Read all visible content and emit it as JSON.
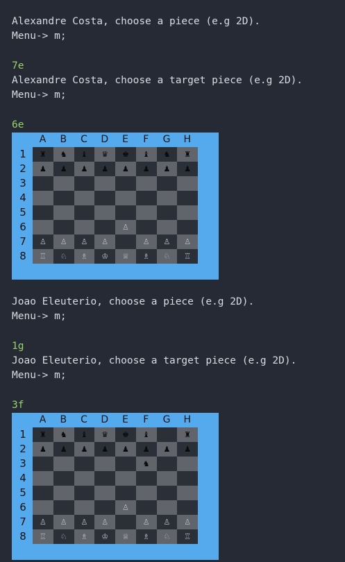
{
  "terminal": {
    "lines": [
      {
        "text": "Alexandre Costa, choose a piece (e.g 2D).",
        "type": "text"
      },
      {
        "text": "Menu-> m;",
        "type": "text"
      },
      {
        "text": "7e",
        "type": "input"
      },
      {
        "text": "Alexandre Costa, choose a target piece (e.g 2D).",
        "type": "text"
      },
      {
        "text": "Menu-> m;",
        "type": "text"
      },
      {
        "text": "6e",
        "type": "input"
      },
      {
        "text": "Joao Eleuterio, choose a piece (e.g 2D).",
        "type": "text"
      },
      {
        "text": "Menu-> m;",
        "type": "text"
      },
      {
        "text": "1g",
        "type": "input"
      },
      {
        "text": "Joao Eleuterio, choose a target piece (e.g 2D).",
        "type": "text"
      },
      {
        "text": "Menu-> m;",
        "type": "text"
      },
      {
        "text": "3f",
        "type": "input"
      }
    ]
  },
  "boards": [
    {
      "columns": [
        "A",
        "B",
        "C",
        "D",
        "E",
        "F",
        "G",
        "H"
      ],
      "rows": [
        "1",
        "2",
        "3",
        "4",
        "5",
        "6",
        "7",
        "8"
      ],
      "squares": [
        [
          "bR",
          "bN",
          "bB",
          "bQ",
          "bK",
          "bB",
          "bN",
          "bR"
        ],
        [
          "bP",
          "bP",
          "bP",
          "bP",
          "bP",
          "bP",
          "bP",
          "bP"
        ],
        [
          "",
          "",
          "",
          "",
          "",
          "",
          "",
          ""
        ],
        [
          "",
          "",
          "",
          "",
          "",
          "",
          "",
          ""
        ],
        [
          "",
          "",
          "",
          "",
          "",
          "",
          "",
          ""
        ],
        [
          "",
          "",
          "",
          "",
          "wP",
          "",
          "",
          ""
        ],
        [
          "wP",
          "wP",
          "wP",
          "wP",
          "",
          "wP",
          "wP",
          "wP"
        ],
        [
          "wR",
          "wN",
          "wB",
          "wK",
          "wQ",
          "wB",
          "wN",
          "wR"
        ]
      ]
    },
    {
      "columns": [
        "A",
        "B",
        "C",
        "D",
        "E",
        "F",
        "G",
        "H"
      ],
      "rows": [
        "1",
        "2",
        "3",
        "4",
        "5",
        "6",
        "7",
        "8"
      ],
      "squares": [
        [
          "bR",
          "bN",
          "bB",
          "bQ",
          "bK",
          "bB",
          "",
          "bR"
        ],
        [
          "bP",
          "bP",
          "bP",
          "bP",
          "bP",
          "bP",
          "bP",
          "bP"
        ],
        [
          "",
          "",
          "",
          "",
          "",
          "bN",
          "",
          ""
        ],
        [
          "",
          "",
          "",
          "",
          "",
          "",
          "",
          ""
        ],
        [
          "",
          "",
          "",
          "",
          "",
          "",
          "",
          ""
        ],
        [
          "",
          "",
          "",
          "",
          "wP",
          "",
          "",
          ""
        ],
        [
          "wP",
          "wP",
          "wP",
          "wP",
          "",
          "wP",
          "wP",
          "wP"
        ],
        [
          "wR",
          "wN",
          "wB",
          "wK",
          "wQ",
          "wB",
          "wN",
          "wR"
        ]
      ]
    }
  ],
  "pieces": {
    "bR": "♜",
    "bN": "♞",
    "bB": "♝",
    "bQ": "♛",
    "bK": "♚",
    "bP": "♟",
    "wR": "♖",
    "wN": "♘",
    "wB": "♗",
    "wQ": "♕",
    "wK": "♔",
    "wP": "♙"
  },
  "colors": {
    "background": "#252a34",
    "text": "#d9dce2",
    "input": "#9bd26b",
    "board_frame": "#55aaee",
    "light_square": "#61646b",
    "dark_square": "#2b2f38"
  }
}
